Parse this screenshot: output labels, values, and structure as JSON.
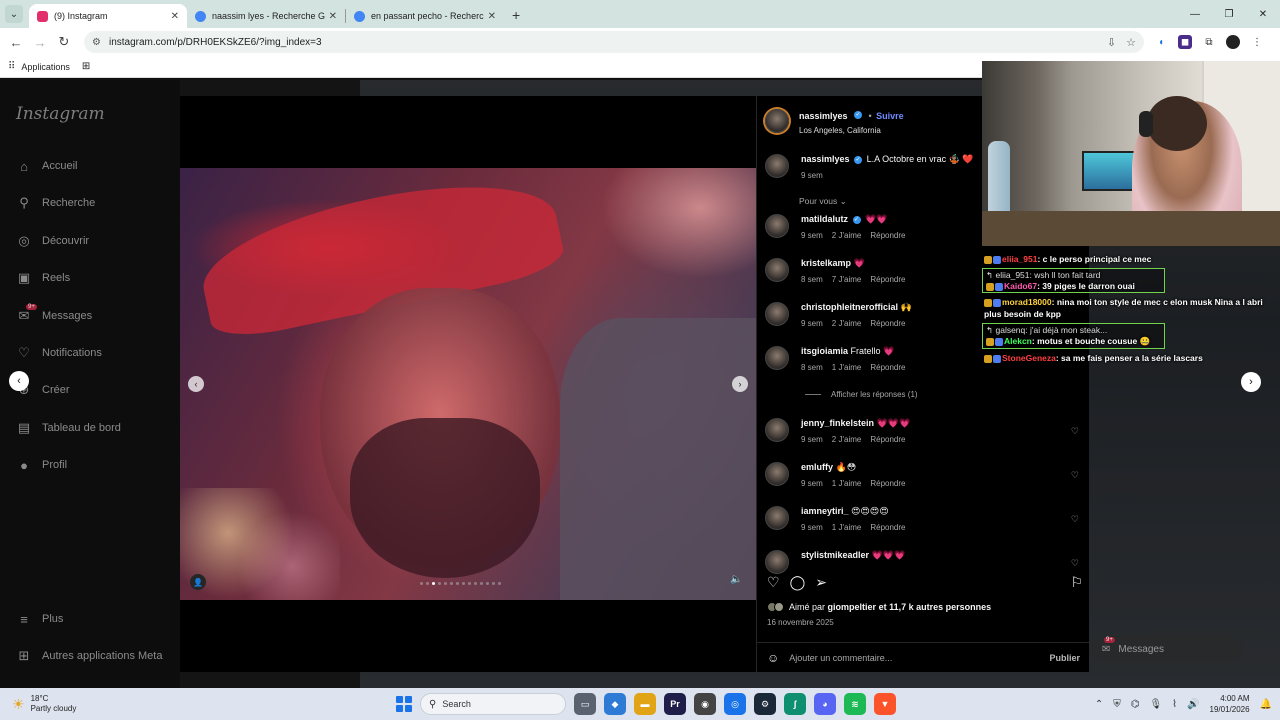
{
  "browser": {
    "tabs": [
      {
        "title": "(9) Instagram",
        "favicon_color": "#e1306c",
        "active": true
      },
      {
        "title": "naassim lyes - Recherche Goog",
        "favicon_color": "#4285f4",
        "active": false
      },
      {
        "title": "en passant pecho - Recherche",
        "favicon_color": "#4285f4",
        "active": false
      }
    ],
    "url": "instagram.com/p/DRH0EKSkZE6/?img_index=3",
    "bookmarks_label": "Applications"
  },
  "sidebar": {
    "logo": "Instagram",
    "items": [
      {
        "label": "Accueil",
        "icon": "home-icon",
        "glyph": "⌂"
      },
      {
        "label": "Recherche",
        "icon": "search-icon",
        "glyph": "⚲"
      },
      {
        "label": "Découvrir",
        "icon": "compass-icon",
        "glyph": "◎"
      },
      {
        "label": "Reels",
        "icon": "reels-icon",
        "glyph": "▣"
      },
      {
        "label": "Messages",
        "icon": "messenger-icon",
        "glyph": "✉",
        "badge": "9+"
      },
      {
        "label": "Notifications",
        "icon": "heart-icon",
        "glyph": "♡"
      },
      {
        "label": "Créer",
        "icon": "plus-icon",
        "glyph": "⊕"
      },
      {
        "label": "Tableau de bord",
        "icon": "dashboard-icon",
        "glyph": "▤"
      },
      {
        "label": "Profil",
        "icon": "profile-icon",
        "glyph": "●"
      }
    ],
    "bottom": [
      {
        "label": "Plus",
        "icon": "menu-icon",
        "glyph": "≡"
      },
      {
        "label": "Autres applications Meta",
        "icon": "meta-icon",
        "glyph": "⊞"
      }
    ]
  },
  "post": {
    "author": "nassimlyes",
    "follow_label": "Suivre",
    "location": "Los Angeles, California",
    "caption_text": "L.A Octobre en vrac 🤹🏽 ❤️",
    "caption_time": "9 sem",
    "section_label": "Pour vous",
    "likes_text": "Aimé par",
    "likes_user": "giompeltier",
    "likes_rest": "et 11,7 k autres personnes",
    "date": "16 novembre 2025",
    "add_comment_placeholder": "Ajouter un commentaire...",
    "publish_label": "Publier",
    "carousel": {
      "count": 14,
      "active": 2
    }
  },
  "comments": [
    {
      "user": "matildalutz",
      "verified": true,
      "text": "💗💗",
      "time": "9 sem",
      "likes": "2 J'aime",
      "reply": "Répondre"
    },
    {
      "user": "kristelkamp",
      "verified": false,
      "text": "💗",
      "time": "8 sem",
      "likes": "7 J'aime",
      "reply": "Répondre"
    },
    {
      "user": "christophleitnerofficial",
      "verified": false,
      "text": "🙌",
      "time": "9 sem",
      "likes": "2 J'aime",
      "reply": "Répondre"
    },
    {
      "user": "itsgioiamia",
      "verified": false,
      "text": "Fratello 💗",
      "time": "8 sem",
      "likes": "1 J'aime",
      "reply": "Répondre"
    },
    {
      "user": "jenny_finkelstein",
      "verified": false,
      "text": "💗💗💗",
      "time": "9 sem",
      "likes": "2 J'aime",
      "reply": "Répondre"
    },
    {
      "user": "emluffy",
      "verified": false,
      "text": "🔥😳",
      "time": "9 sem",
      "likes": "1 J'aime",
      "reply": "Répondre"
    },
    {
      "user": "iamneytiri_",
      "verified": false,
      "text": "😍😍😍😍",
      "time": "9 sem",
      "likes": "1 J'aime",
      "reply": "Répondre"
    },
    {
      "user": "stylistmikeadler",
      "verified": false,
      "text": "💗💗💗",
      "time": "",
      "likes": "",
      "reply": ""
    }
  ],
  "show_replies": "Afficher les réponses (1)",
  "stream_chat": [
    {
      "type": "msg",
      "name": "eliia_951",
      "name_color": "red",
      "text": ": c le perso principal ce mec"
    },
    {
      "type": "box",
      "reply": "↰ eliia_951: wsh ll ton fait tard",
      "name": "Kaido67",
      "name_color": "pink",
      "text": ": 39 piges le darron ouai"
    },
    {
      "type": "msg",
      "name": "morad18000",
      "name_color": "yel",
      "text": ": nina moi ton style de mec c elon musk Nina a l abri plus besoin de kpp"
    },
    {
      "type": "box",
      "reply": "↰ galsenq: j'ai déjà mon steak...",
      "name": "Alekcn",
      "name_color": "green",
      "text": ": motus et bouche cousue 🤐"
    },
    {
      "type": "msg",
      "name": "StoneGeneza",
      "name_color": "red",
      "text": ": sa me fais penser a la série lascars"
    }
  ],
  "messages_pill": {
    "label": "Messages",
    "badge": "9+"
  },
  "taskbar": {
    "temp": "18°C",
    "weather": "Partly cloudy",
    "search_label": "Search",
    "time": "4:00 AM",
    "date": "19/01/2026"
  }
}
